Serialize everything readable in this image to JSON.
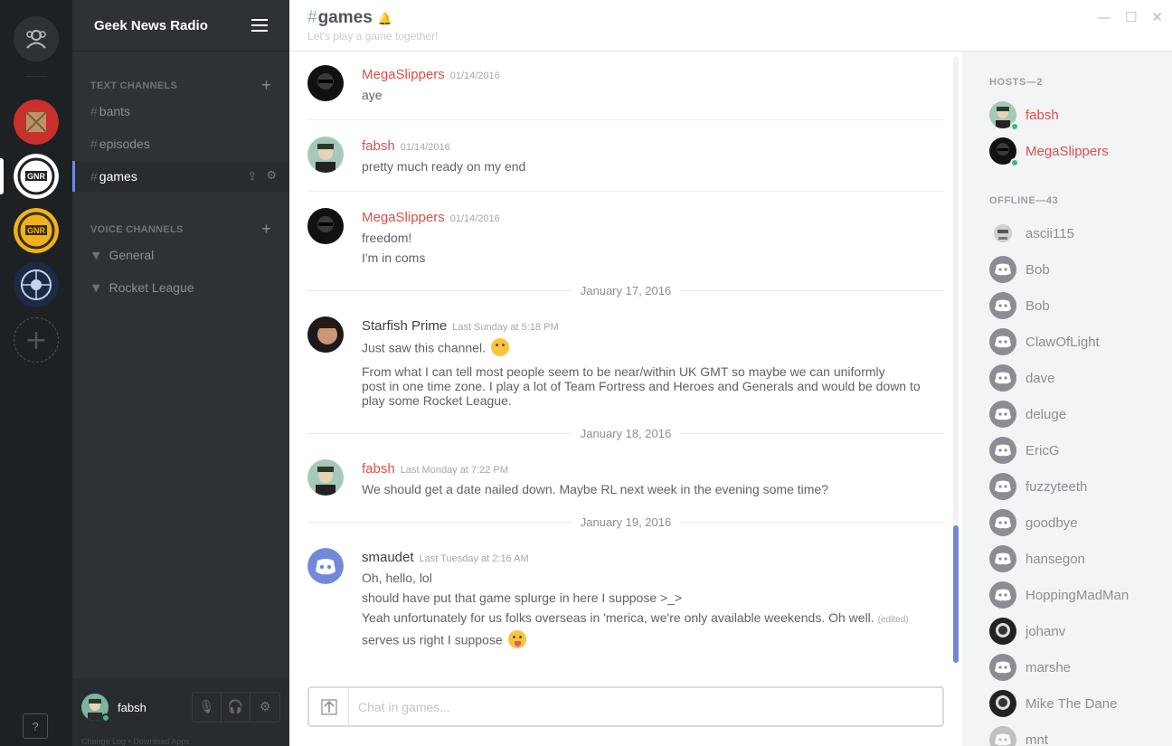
{
  "server": {
    "name": "Geek News Radio",
    "text_channels_label": "TEXT CHANNELS",
    "voice_channels_label": "VOICE CHANNELS",
    "text_channels": [
      {
        "name": "bants"
      },
      {
        "name": "episodes"
      },
      {
        "name": "games"
      }
    ],
    "voice_channels": [
      {
        "name": "General"
      },
      {
        "name": "Rocket League"
      }
    ],
    "active_channel": "games"
  },
  "user_panel": {
    "username": "fabsh",
    "footer_links": "Change Log  •  Download Apps"
  },
  "rail": {
    "help_label": "?",
    "add_label": "+"
  },
  "chat": {
    "hash": "#",
    "channel": "games",
    "topic": "Let's play a game together!",
    "composer_placeholder": "Chat in games..."
  },
  "messages": [
    {
      "author": "MegaSlippers",
      "time": "01/14/2016",
      "lines": [
        "aye"
      ]
    },
    {
      "author": "fabsh",
      "time": "01/14/2016",
      "lines": [
        "pretty much ready on my end"
      ]
    },
    {
      "author": "MegaSlippers",
      "time": "01/14/2016",
      "lines": [
        "freedom!",
        "I'm in coms"
      ]
    },
    {
      "author": "Starfish Prime",
      "time": "Last Sunday at 5:18 PM",
      "lines": [
        "Just saw this channel.",
        "From what I can tell most people  seem to be near/within UK GMT so maybe we can uniformly",
        "post in one time zone. I play a lot of Team Fortress and Heroes and Generals and would be down to",
        "play some Rocket League."
      ]
    },
    {
      "author": "fabsh",
      "time": "Last Monday at 7:22 PM",
      "lines": [
        "We should get a date nailed down. Maybe RL next week in the evening some time?"
      ]
    },
    {
      "author": "smaudet",
      "time": "Last Tuesday at 2:16 AM",
      "lines": [
        "Oh, hello, lol",
        "should have put that game splurge in here I suppose >_>",
        "Yeah unfortunately for us folks overseas in 'merica, we're only available weekends. Oh well.",
        "serves us right I suppose"
      ],
      "edited_label": "(edited)"
    }
  ],
  "date_dividers": [
    "January 17, 2016",
    "January 18, 2016",
    "January 19, 2016"
  ],
  "members": {
    "hosts_label": "HOSTS—2",
    "offline_label": "OFFLINE—43",
    "hosts": [
      "fabsh",
      "MegaSlippers"
    ],
    "offline": [
      "ascii115",
      "Bob",
      "Bob",
      "ClawOfLight",
      "dave",
      "deluge",
      "EricG",
      "fuzzyteeth",
      "goodbye",
      "hansegon",
      "HoppingMadMan",
      "johanv",
      "marshe",
      "Mike The Dane",
      "mnt"
    ]
  },
  "colors": {
    "accent": "#7289da",
    "host_name": "#d9504a",
    "online": "#43b581"
  }
}
